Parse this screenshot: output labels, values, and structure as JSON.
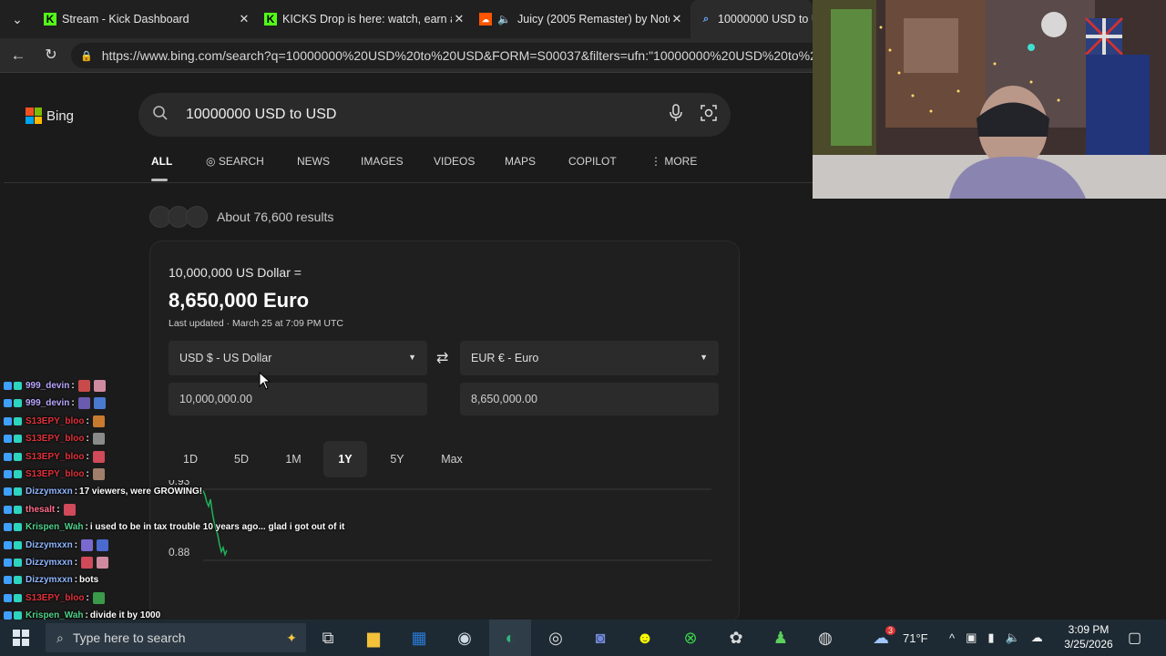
{
  "browser": {
    "tabs": [
      {
        "title": "Stream - Kick Dashboard",
        "favicon": "kick-icon"
      },
      {
        "title": "KICKS Drop is here: watch, earn and",
        "favicon": "kick-icon"
      },
      {
        "title": "Juicy (2005 Remaster) by Notorious B.I.G.",
        "favicon": "soundcloud-icon"
      },
      {
        "title": "10000000 USD to USD",
        "favicon": "search-icon"
      }
    ],
    "url": "https://www.bing.com/search?q=10000000%20USD%20to%20USD&FORM=S00037&filters=ufn:\"10000000%20USD%20to%20USD"
  },
  "bing": {
    "logo_text": "Bing",
    "query": "10000000 USD to USD",
    "nav": [
      "ALL",
      "SEARCH",
      "NEWS",
      "IMAGES",
      "VIDEOS",
      "MAPS",
      "COPILOT",
      "MORE"
    ],
    "results_count": "About 76,600 results"
  },
  "converter": {
    "from_label": "10,000,000 US Dollar =",
    "result": "8,650,000 Euro",
    "updated": "Last updated · March 25 at 7:09 PM UTC",
    "from_currency": "USD $ - US Dollar",
    "to_currency": "EUR € - Euro",
    "from_amount": "10,000,000.00",
    "to_amount": "8,650,000.00",
    "ranges": [
      "1D",
      "5D",
      "1M",
      "1Y",
      "5Y",
      "Max"
    ],
    "active_range": "1Y"
  },
  "chart_data": {
    "type": "line",
    "y_ticks": [
      "0.93",
      "0.88"
    ],
    "ylim": [
      0.88,
      0.93
    ],
    "series": [
      {
        "values": [
          0.929,
          0.926,
          0.921,
          0.918,
          0.923,
          0.914,
          0.907,
          0.902,
          0.898,
          0.891,
          0.886,
          0.889,
          0.884,
          0.887
        ]
      }
    ],
    "color": "#1fb25a"
  },
  "chat": [
    {
      "user": "999_devin",
      "msg": "",
      "color": "#b9a7ff",
      "emotes": [
        "#c94a4a",
        "#d08aa0"
      ]
    },
    {
      "user": "999_devin",
      "msg": "",
      "color": "#b9a7ff",
      "emotes": [
        "#6a5ab0",
        "#4a7ad0"
      ]
    },
    {
      "user": "S13EPY_bloo",
      "msg": "",
      "color": "#e0323a",
      "emotes": [
        "#c87a30"
      ]
    },
    {
      "user": "S13EPY_bloo",
      "msg": "",
      "color": "#e0323a",
      "emotes": [
        "#8a8a8a"
      ]
    },
    {
      "user": "S13EPY_bloo",
      "msg": "",
      "color": "#e0323a",
      "emotes": [
        "#d04a5a"
      ]
    },
    {
      "user": "S13EPY_bloo",
      "msg": "",
      "color": "#e0323a",
      "emotes": [
        "#a0806a"
      ]
    },
    {
      "user": "Dizzymxxn",
      "msg": "17 viewers, were GROWING!",
      "color": "#8fb6ff",
      "emotes": []
    },
    {
      "user": "thesalt",
      "msg": "",
      "color": "#ff6b8a",
      "emotes": [
        "#d04a5a"
      ]
    },
    {
      "user": "Krispen_Wah",
      "msg": "i used to be in tax trouble 10 years ago... glad i got out of it",
      "color": "#4fd18b",
      "emotes": []
    },
    {
      "user": "Dizzymxxn",
      "msg": "",
      "color": "#8fb6ff",
      "emotes": [
        "#7a6ad0",
        "#4a6ad0"
      ]
    },
    {
      "user": "Dizzymxxn",
      "msg": "",
      "color": "#8fb6ff",
      "emotes": [
        "#d04a5a",
        "#d08aa0"
      ]
    },
    {
      "user": "Dizzymxxn",
      "msg": "bots",
      "color": "#8fb6ff",
      "emotes": []
    },
    {
      "user": "S13EPY_bloo",
      "msg": "",
      "color": "#e0323a",
      "emotes": [
        "#3a9a4a"
      ]
    },
    {
      "user": "Krispen_Wah",
      "msg": "divide it by 1000",
      "color": "#4fd18b",
      "emotes": []
    }
  ],
  "taskbar": {
    "search_placeholder": "Type here to search",
    "weather_temp": "71°F",
    "notification_count": "3",
    "time": "3:09 PM",
    "date": "3/25/2026"
  }
}
